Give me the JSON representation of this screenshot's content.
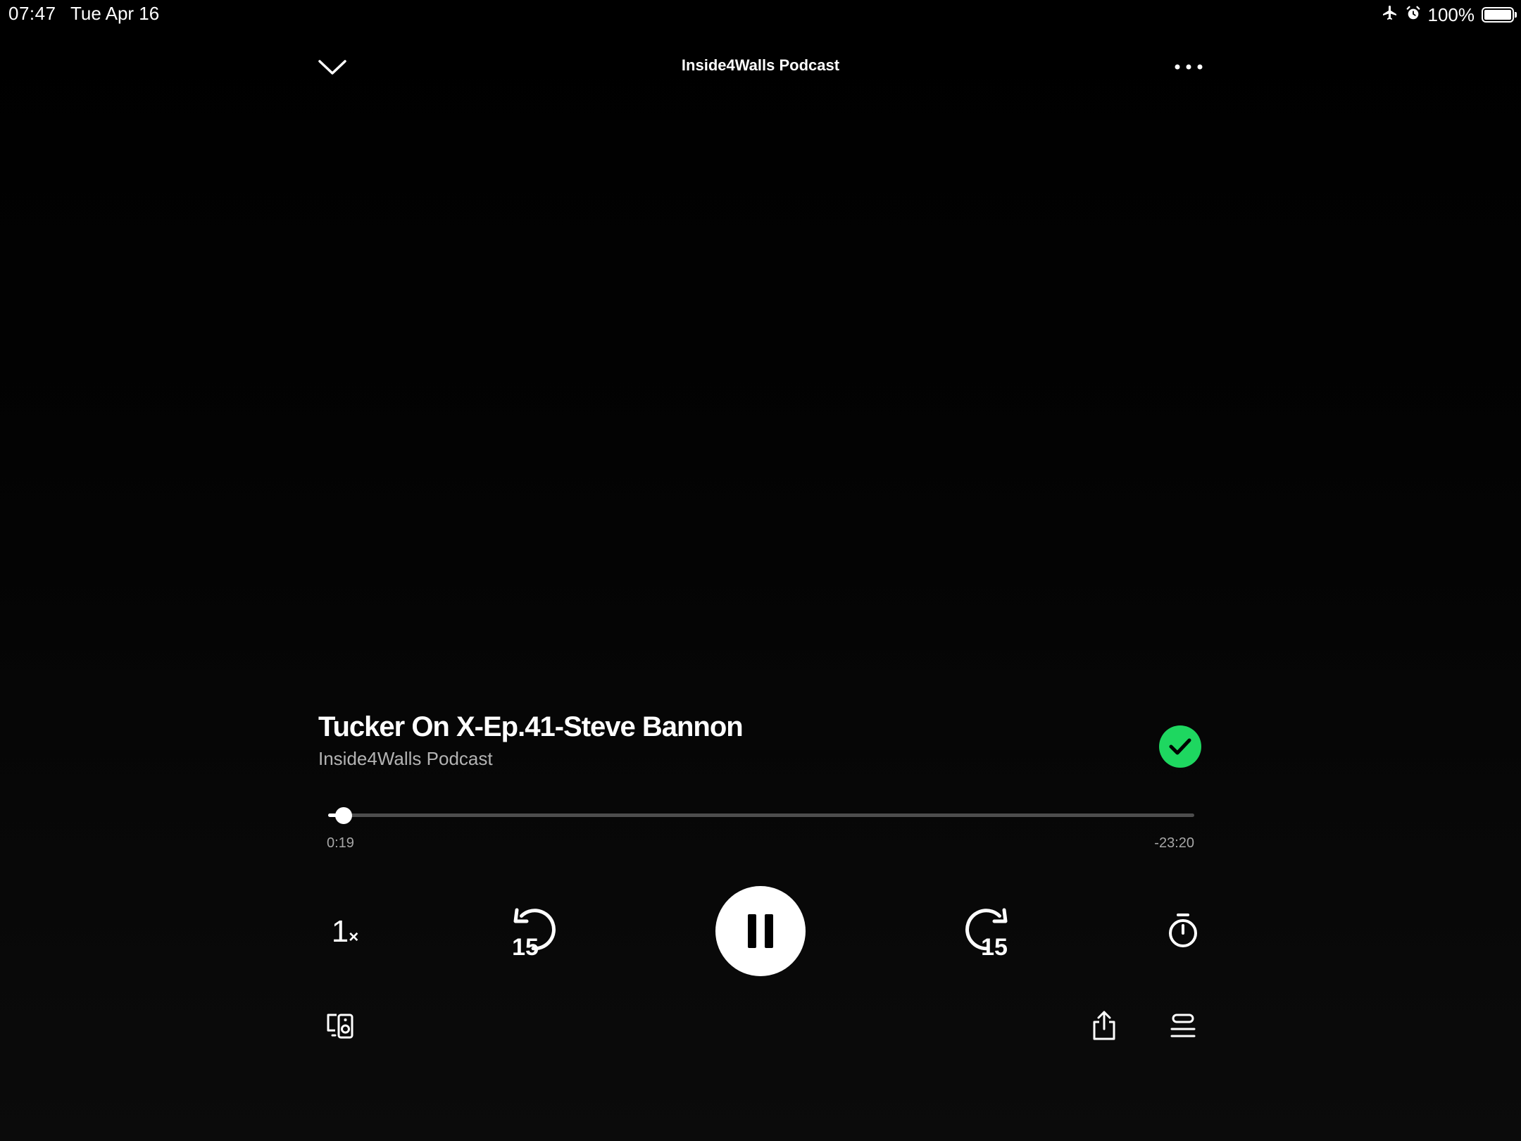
{
  "status_bar": {
    "time": "07:47",
    "date": "Tue Apr 16",
    "battery_text": "100%",
    "battery_level": 1.0,
    "icons": [
      "airplane-icon",
      "alarm-icon",
      "battery-icon"
    ]
  },
  "header": {
    "title": "Inside4Walls Podcast",
    "collapse_icon": "chevron-down-icon",
    "more_icon": "more-horizontal-icon"
  },
  "episode": {
    "title": "Tucker On X-Ep.41-Steve Bannon",
    "show": "Inside4Walls Podcast",
    "added_icon": "check-icon"
  },
  "progress": {
    "elapsed": "0:19",
    "remaining": "-23:20",
    "fraction": 0.0134
  },
  "controls": {
    "speed_number": "1",
    "speed_suffix": "×",
    "skip_back_seconds": "15",
    "skip_forward_seconds": "15",
    "state": "playing"
  },
  "bottom_bar": {
    "icons": [
      "connect-device-icon",
      "share-icon",
      "queue-icon"
    ]
  },
  "colors": {
    "accent": "#1ed760",
    "background": "#000000",
    "secondary_text": "#b3b3b3"
  }
}
